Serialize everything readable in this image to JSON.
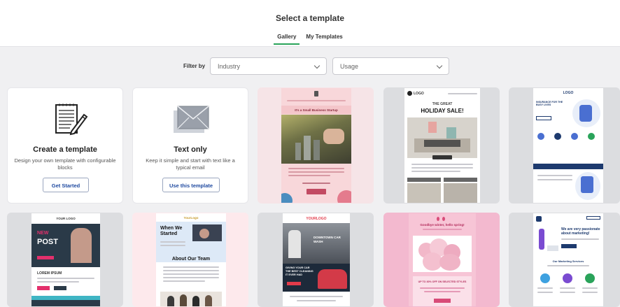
{
  "header": {
    "title": "Select a template",
    "tabs": [
      {
        "label": "Gallery",
        "active": true
      },
      {
        "label": "My Templates",
        "active": false
      }
    ]
  },
  "filters": {
    "label": "Filter by",
    "industry": {
      "value": "Industry"
    },
    "usage": {
      "value": "Usage"
    }
  },
  "cards": {
    "create": {
      "title": "Create a template",
      "desc": "Design your own template with configurable blocks",
      "button": "Get Started",
      "icon": "notepad-pencil-icon"
    },
    "text_only": {
      "title": "Text only",
      "desc": "Keep it simple and start with text like a typical email",
      "button": "Use this template",
      "icon": "envelope-icon"
    }
  },
  "templates": {
    "small_business": {
      "headline": "It's a Small Business Startup"
    },
    "holiday": {
      "logo": "LOGO",
      "line1": "THE GREAT",
      "line2": "HOLIDAY SALE!"
    },
    "insurance": {
      "logo": "LOGO",
      "headline": "INSURANCE FOR THE BUSY LIVES"
    },
    "new_post": {
      "logo": "YOUR LOGO",
      "line1": "NEW",
      "line2": "POST",
      "subhead": "LOREM IPSUM"
    },
    "team": {
      "logo": "YourLogo",
      "headline1": "When We Started",
      "headline2": "About Our Team"
    },
    "car_wash": {
      "logo": "YOURLOGO",
      "headline": "DOWNTOWN CAR WASH",
      "offer": "GIVING YOUR CAR THE BEST CLEANING IT EVER HAD"
    },
    "spring": {
      "headline": "Goodbye winter, hello spring!",
      "offer": "UP TO 30% OFF ON SELECTED STYLES"
    },
    "marketing": {
      "headline": "We are very passionate about marketing!",
      "subhead": "Our Marketing Services"
    }
  },
  "colors": {
    "accent_green": "#2aa35a",
    "link_blue": "#1f4aa0",
    "pink": "#f3b9cf",
    "navy": "#1d3a6e"
  }
}
